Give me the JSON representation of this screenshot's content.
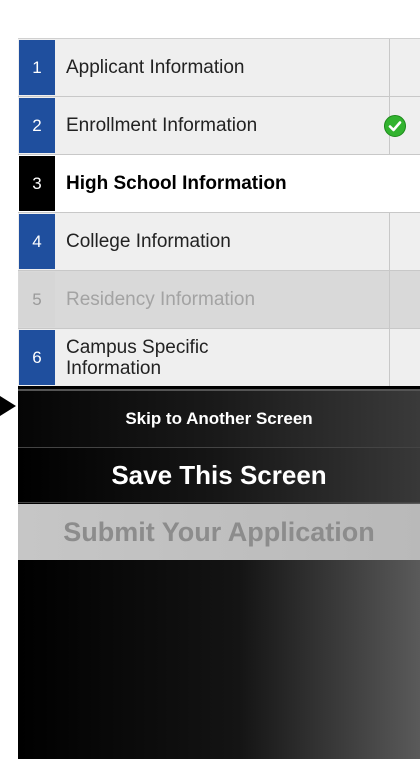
{
  "steps": [
    {
      "number": "1",
      "label": "Applicant Information",
      "state": "normal",
      "complete": false
    },
    {
      "number": "2",
      "label": "Enrollment Information",
      "state": "normal",
      "complete": true
    },
    {
      "number": "3",
      "label": "High School Information",
      "state": "active",
      "complete": false
    },
    {
      "number": "4",
      "label": "College Information",
      "state": "normal",
      "complete": false
    },
    {
      "number": "5",
      "label": "Residency Information",
      "state": "disabled",
      "complete": false
    },
    {
      "number": "6",
      "label": "Campus Specific Information",
      "state": "normal",
      "complete": false
    }
  ],
  "actions": {
    "skip_label": "Skip to Another Screen",
    "save_label": "Save This Screen",
    "submit_label": "Submit Your Application"
  },
  "colors": {
    "step_number_bg": "#1f4f9e",
    "active_number_bg": "#000000",
    "check_green": "#32b32f"
  }
}
